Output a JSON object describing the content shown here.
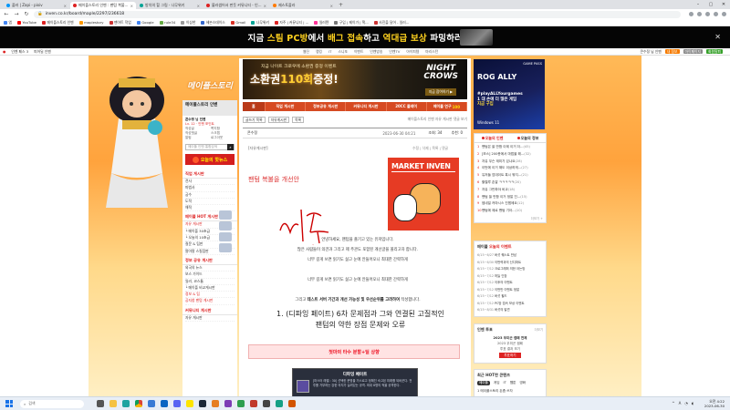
{
  "browser": {
    "tabs": [
      {
        "label": "플러 | Zapi - pixiv",
        "color": "#0096fa",
        "active": false
      },
      {
        "label": "메이플스토리 인벤 : 팬텀 복불...",
        "color": "#d22",
        "active": true
      },
      {
        "label": "방치의 힐 그림 - 나무위키",
        "color": "#00a495",
        "active": false
      },
      {
        "label": "블라썸어서 펀듯 커뮤니티 - 인...",
        "color": "#d22",
        "active": false
      },
      {
        "label": "제스토플라",
        "color": "#ff7a00",
        "active": false
      }
    ],
    "url": "inven.co.kr/board/maple/2297/236618",
    "bookmarks": [
      {
        "label": "앱",
        "color": "#4285f4"
      },
      {
        "label": "YouTube",
        "color": "#f00"
      },
      {
        "label": "메이플스토리 인벤",
        "color": "#d22"
      },
      {
        "label": "maplestory",
        "color": "#f90"
      },
      {
        "label": "팬아트 작업",
        "color": "#c33"
      },
      {
        "label": "Google",
        "color": "#4285f4"
      },
      {
        "label": "rule34",
        "color": "#6a4"
      },
      {
        "label": "이상한",
        "color": "#999"
      },
      {
        "label": "헤븐스데이스",
        "color": "#36c"
      },
      {
        "label": "Gmail",
        "color": "#d93025"
      },
      {
        "label": "나무위키",
        "color": "#00a495"
      },
      {
        "label": "자주 | 커뮤니티 | ...",
        "color": "#d22"
      },
      {
        "label": "일러텐",
        "color": "#f39"
      },
      {
        "label": "구입 | 제이가 | 잭...",
        "color": "#777"
      },
      {
        "label": "사진을 달어 - 일러...",
        "color": "#c33"
      }
    ]
  },
  "banner": {
    "part1": "지금 ",
    "part2": "스팀 PC방",
    "part3": "에서 ",
    "part4": "배그 접속",
    "part5": "하고 ",
    "part6": "역대급 보상",
    "part7": " 파밍하러 가기"
  },
  "inven_bar": {
    "left": [
      "인벤 페스 3",
      "피어딜 인벤"
    ],
    "mid": [
      "웹진",
      "랭킹",
      "IT",
      "스니또",
      "이벤트",
      "인벤방송",
      "인벤TV",
      "아이피템",
      "마리스턴"
    ],
    "user": "콘수정 님 인벤",
    "btn1": "내 정보",
    "btn2": "마이페이지",
    "btn3": "회원탈퇴"
  },
  "logo": "메이플스토리",
  "left_nav": {
    "title": "메이플스토리 인벤",
    "user": "콘수정 님 인벤",
    "level": "Lv. 12 · 인벤 포인트",
    "grid": [
      "작성글",
      "쪽지함",
      "작성댓글",
      "스크랩",
      "알림",
      "로그아웃"
    ],
    "search_placeholder": "메이플 인벤 통합검색",
    "hot_btn": "오늘의 핫뉴스",
    "sec1": "직업 게시판",
    "list1": [
      "전사",
      "마법사",
      "궁수",
      "도적",
      "해적"
    ],
    "sec2": "메이플 HOT 게시판",
    "list2": [
      "자유 게시판",
      "└ 메이플 30초급",
      "└ 오늘의 10초급",
      "질문 & 팁판",
      "팔아팔 스킬점판"
    ],
    "sec3": "정보 공유 게시판",
    "list3": [
      "외국의 뉴스",
      "보스 가이드",
      "일러, 코스튬",
      "└ 메이플 비교게시판",
      "정보 & 팁",
      "공지창 팬텀 게시판"
    ],
    "sec4": "커뮤니티 게시판",
    "list4": [
      "자유 게시판"
    ]
  },
  "ad_top": {
    "sub": "지금 나이트 크로우에 소환권 증정 이벤트",
    "title_a": "소환권",
    "title_b": "110회",
    "title_c": "증정!",
    "logo_a": "NIGHT",
    "logo_b": "CROWS",
    "btn": "지금 참여하기 ▶"
  },
  "main_tabs": [
    {
      "label": "홈",
      "new": ""
    },
    {
      "label": "직업 게시판",
      "new": ""
    },
    {
      "label": "정보공유 게시판",
      "new": ""
    },
    {
      "label": "커뮤니티 게시판",
      "new": ""
    },
    {
      "label": "20CC 플레이",
      "new": ""
    },
    {
      "label": "메이플 연구",
      "new": "100"
    }
  ],
  "post": {
    "buttons": [
      "글쓰기 목록",
      "자유게시판",
      "목록"
    ],
    "board_name": "메이플스토리 인벤 자유 게시판 댓글 보기",
    "author": "콘수정",
    "date": "2023-06-30 04:21",
    "views": "조회: 34",
    "rec": "추천: 0",
    "category": "[자유게시판]",
    "links": "수정 | 삭제 | 목록 | 댓글",
    "title": "팬텀 복불을 개선안",
    "body": [
      "안녕하세요, 팬텀을 즐기고 있는 유저입니다.",
      "많은 사람들이 의견과 그리고 제 주관도 포함된 개선글을 올리고자 합니다.",
      "너무 길게 쓰면 읽기도 싫고 눈에 안들어오니 최대한 간략하게",
      "",
      "너무 길게 쓰면 읽기도 싫고 눈에 안들어오니 최대한 간략하게",
      "",
      "그리고 테스트 서버 기간과 개선 가능성 및 우선순위를 고려하여 작성합니다."
    ],
    "bold_phrase": "테스트 서버 기간과 개선 가능성 및 우선순위를 고려하여",
    "section1_a": "1. (디파잉 페이트) 6차 문제점과 그와 연결된 고질적인",
    "section1_b": "팬텀의 약한 장점 문제와 오류",
    "pink": "첫마의 타수 분할+딜 상향",
    "handwritten": "시작",
    "market": "MARKET INVEN",
    "dcard_title": "디파잉 페이트",
    "dcard_text": "[마스터 레벨 : 30] 선택한 운명을 거스르고 정해진 숙고된 미래를 되바꾼다. 전투를 거부하는 강한 의지가 실려있는 공격. 최대 8명의 적을 공격한다."
  },
  "right_ad": {
    "gp": "GAME PASS",
    "title": "ROG ALLY",
    "h1": "#playALLYourgames",
    "h2": "1 대 손에 더 많은 게임",
    "h3": "지금 구입",
    "win": "Windows 11"
  },
  "right_panel": {
    "tab1": "오늘의 인벤",
    "tab2": "오늘의 정보",
    "items": [
      {
        "n": "1",
        "t": "팬텀은 쓸 만함 이제 이거 더...",
        "c": "(45)"
      },
      {
        "n": "2",
        "t": "[보스] 200층에서 마법을 해...",
        "c": "(32)"
      },
      {
        "n": "3",
        "t": "자유 무슨 재미가 있냐요",
        "c": "(28)"
      },
      {
        "n": "4",
        "t": "이번에 이거 해도 이상하게...",
        "c": "(27)"
      },
      {
        "n": "5",
        "t": "유저들 업데이트 혹시 뭐지...",
        "c": "(21)"
      },
      {
        "n": "6",
        "t": "할렐루 존잘 ㅋㅋㅋㅋㅋ",
        "c": "(20)"
      },
      {
        "n": "7",
        "t": "자유 그만파야 비교",
        "c": "(18)"
      },
      {
        "n": "8",
        "t": "팬텀 쓸 만함 이거 정말 진...",
        "c": "(15)"
      },
      {
        "n": "9",
        "t": "썸네일 카마시스 진잼에요",
        "c": "(12)"
      },
      {
        "n": "10",
        "t": "팬텀에 제로 팬텀 기아...",
        "c": "(10)"
      }
    ],
    "more": "더보기 +"
  },
  "events": {
    "title_a": "메이플 ",
    "title_b": "오늘의 이벤트",
    "items": [
      {
        "d": "6/15~6/27",
        "t": "버섯 퀘스트 만남"
      },
      {
        "d": "6/15~6/30",
        "t": "이번력과의 신디파트"
      },
      {
        "d": "6/15~7/12",
        "t": "크로그래퍼 의한 아는방"
      },
      {
        "d": "6/15~7/12",
        "t": "하늘 인장"
      },
      {
        "d": "6/15~7/12",
        "t": "이후의 이벤트"
      },
      {
        "d": "6/15~7/12",
        "t": "이번만 이벤트 정말"
      },
      {
        "d": "6/15~7/12",
        "t": "버섯 필드"
      },
      {
        "d": "6/15~7/12",
        "t": "PC방 접속 보상 이벤트"
      },
      {
        "d": "6/15~8/31",
        "t": "버섯의 발견"
      }
    ]
  },
  "rsvp": {
    "title": "인벤 투표",
    "more": "더보기",
    "line1": "2023 우미곤 캠페 전체",
    "line2": "2023 우미곤 캠페",
    "line3": "투표 결과 보기",
    "btn": "투표하기"
  },
  "hot_content": {
    "title": "최근 HOT한 콘텐츠",
    "tabs": [
      "메이플",
      "게임",
      "IT",
      "웹툰",
      "영화"
    ],
    "item": "1  메이플스토리 돈좀 쓰자"
  },
  "taskbar": {
    "search": "검색",
    "time": "오전 4:22",
    "date": "2023-06-30",
    "lang": "A"
  }
}
